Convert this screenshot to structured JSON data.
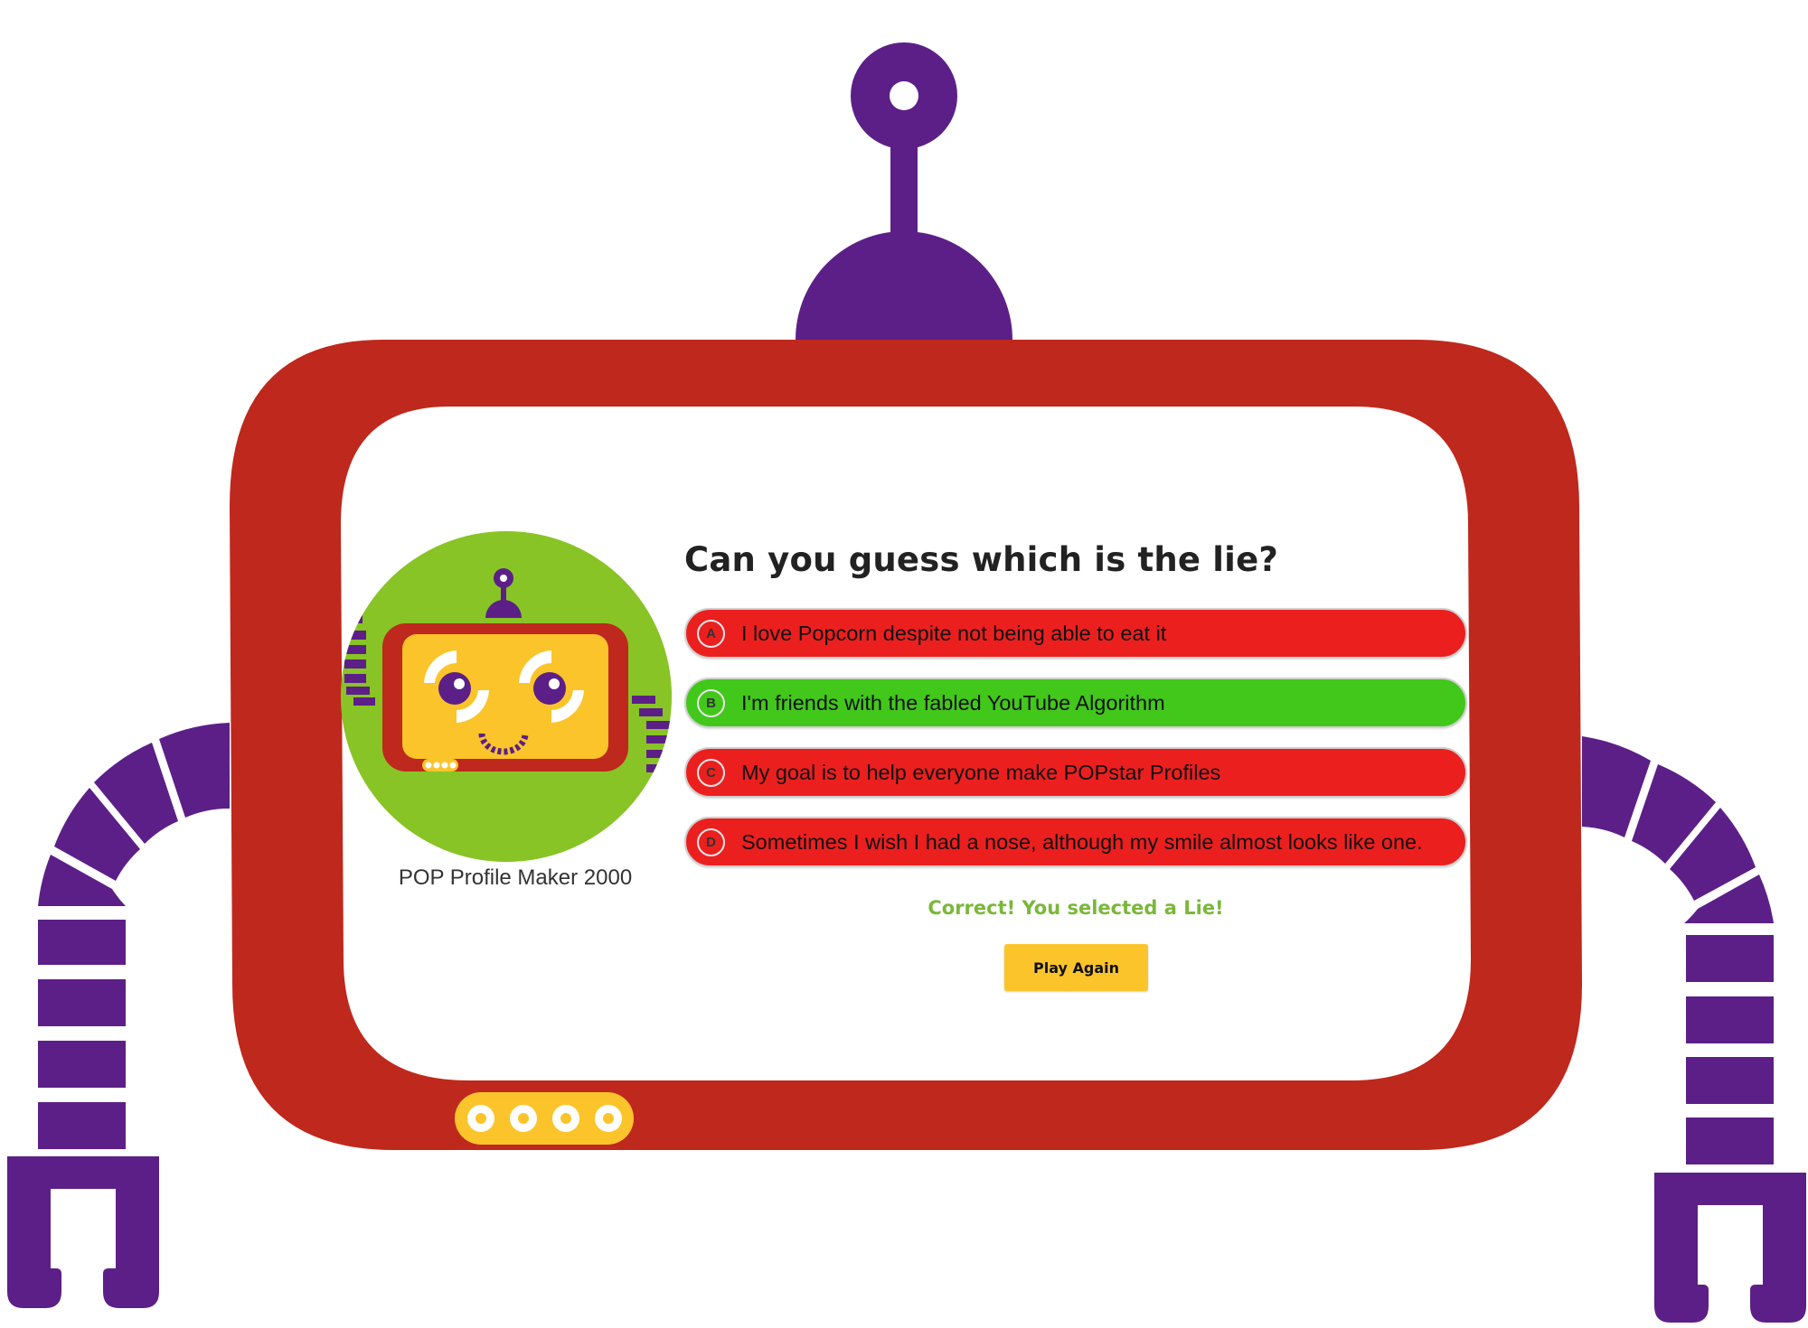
{
  "colors": {
    "frame_red": "#bf281c",
    "robot_purple": "#5c1f87",
    "avatar_green": "#88c425",
    "accent_yellow": "#fbc42b",
    "option_wrong": "#ec1f1f",
    "option_correct": "#42c71b",
    "status_green": "#7ab83a"
  },
  "avatar": {
    "caption": "POP Profile Maker 2000",
    "icon": "robot-avatar-icon"
  },
  "quiz": {
    "question": "Can you guess which is the lie?",
    "options": [
      {
        "letter": "A",
        "text": "I love Popcorn despite not being able to eat it",
        "state": "wrong"
      },
      {
        "letter": "B",
        "text": "I'm friends with the fabled YouTube Algorithm",
        "state": "correct"
      },
      {
        "letter": "C",
        "text": "My goal is to help everyone make POPstar Profiles",
        "state": "wrong"
      },
      {
        "letter": "D",
        "text": "Sometimes I wish I had a nose, although my smile almost looks like one.",
        "state": "wrong"
      }
    ],
    "status": "Correct! You selected a Lie!",
    "play_again_label": "Play Again"
  }
}
